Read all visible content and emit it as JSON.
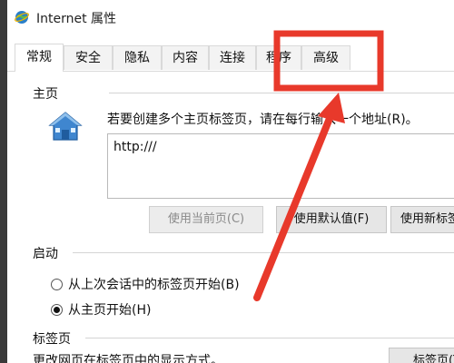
{
  "window": {
    "title": "Internet 属性",
    "icon": "globe-icon"
  },
  "tabs": [
    {
      "label": "常规",
      "active": true
    },
    {
      "label": "安全",
      "active": false
    },
    {
      "label": "隐私",
      "active": false
    },
    {
      "label": "内容",
      "active": false
    },
    {
      "label": "连接",
      "active": false
    },
    {
      "label": "程序",
      "active": false
    },
    {
      "label": "高级",
      "active": false
    }
  ],
  "homepage": {
    "section_title": "主页",
    "description": "若要创建多个主页标签页，请在每行输入一个地址(R)。",
    "url_value": "http:///",
    "buttons": {
      "use_current": "使用当前页(C)",
      "use_default": "使用默认值(F)",
      "use_new_tab": "使用新标签页(U)"
    }
  },
  "startup": {
    "section_title": "启动",
    "option_last_session": "从上次会话中的标签页开始(B)",
    "option_homepage": "从主页开始(H)",
    "selected": "option_homepage"
  },
  "tabs_section": {
    "section_title": "标签页",
    "description": "更改网页在标签页中的显示方式。",
    "button": "标签页(T)"
  },
  "annotation": {
    "highlight_color": "#e8392b"
  }
}
